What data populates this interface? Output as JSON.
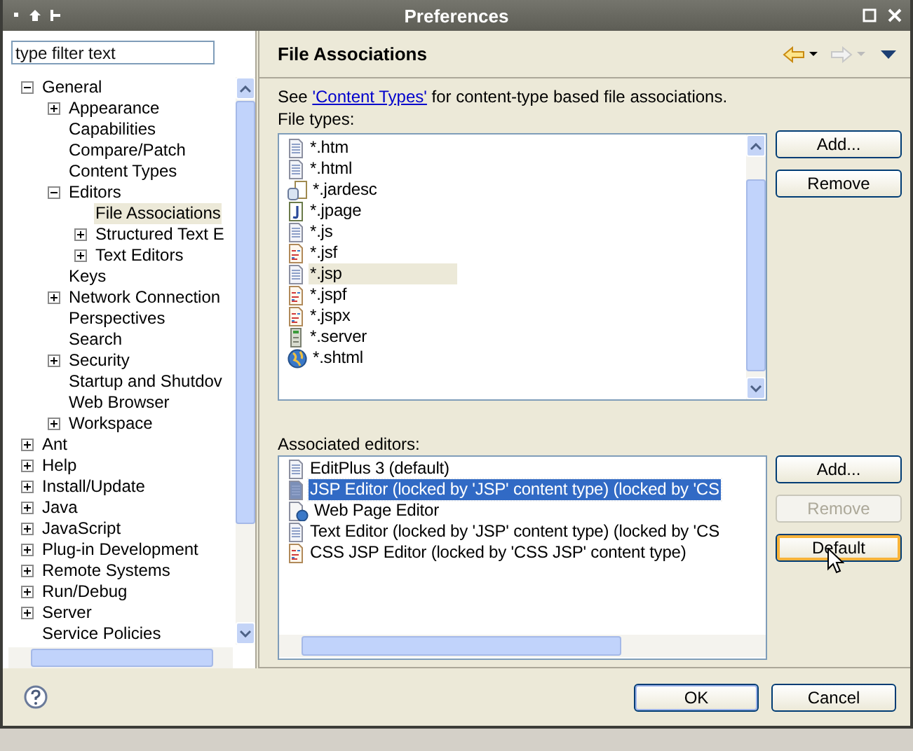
{
  "window": {
    "title": "Preferences"
  },
  "filter": {
    "placeholder": "type filter text"
  },
  "tree": [
    {
      "label": "General",
      "expanded": true,
      "selected": false,
      "children": [
        {
          "label": "Appearance",
          "expanded": false,
          "selected": false
        },
        {
          "label": "Capabilities",
          "selected": false
        },
        {
          "label": "Compare/Patch",
          "selected": false
        },
        {
          "label": "Content Types",
          "selected": false
        },
        {
          "label": "Editors",
          "expanded": true,
          "selected": false,
          "children": [
            {
              "label": "File Associations",
              "selected": true
            },
            {
              "label": "Structured Text E",
              "expanded": false,
              "selected": false
            },
            {
              "label": "Text Editors",
              "expanded": false,
              "selected": false
            }
          ]
        },
        {
          "label": "Keys",
          "selected": false
        },
        {
          "label": "Network Connection",
          "expanded": false,
          "selected": false
        },
        {
          "label": "Perspectives",
          "selected": false
        },
        {
          "label": "Search",
          "selected": false
        },
        {
          "label": "Security",
          "expanded": false,
          "selected": false
        },
        {
          "label": "Startup and Shutdov",
          "selected": false
        },
        {
          "label": "Web Browser",
          "selected": false
        },
        {
          "label": "Workspace",
          "expanded": false,
          "selected": false
        }
      ]
    },
    {
      "label": "Ant",
      "expanded": false,
      "selected": false
    },
    {
      "label": "Help",
      "expanded": false,
      "selected": false
    },
    {
      "label": "Install/Update",
      "expanded": false,
      "selected": false
    },
    {
      "label": "Java",
      "expanded": false,
      "selected": false
    },
    {
      "label": "JavaScript",
      "expanded": false,
      "selected": false
    },
    {
      "label": "Plug-in Development",
      "expanded": false,
      "selected": false
    },
    {
      "label": "Remote Systems",
      "expanded": false,
      "selected": false
    },
    {
      "label": "Run/Debug",
      "expanded": false,
      "selected": false
    },
    {
      "label": "Server",
      "expanded": false,
      "selected": false
    },
    {
      "label": "Service Policies",
      "selected": false
    }
  ],
  "page": {
    "title": "File Associations",
    "intro_before": "See ",
    "link": "'Content Types'",
    "intro_after": " for content-type based file associations."
  },
  "file_types": {
    "label": "File types:",
    "items": [
      {
        "name": "*.htm",
        "kind": "doc",
        "selected": false
      },
      {
        "name": "*.html",
        "kind": "doc",
        "selected": false
      },
      {
        "name": "*.jardesc",
        "kind": "jar",
        "selected": false
      },
      {
        "name": "*.jpage",
        "kind": "jpage",
        "selected": false
      },
      {
        "name": "*.js",
        "kind": "doc",
        "selected": false
      },
      {
        "name": "*.jsf",
        "kind": "form",
        "selected": false
      },
      {
        "name": "*.jsp",
        "kind": "doc",
        "selected": true
      },
      {
        "name": "*.jspf",
        "kind": "form",
        "selected": false
      },
      {
        "name": "*.jspx",
        "kind": "form",
        "selected": false
      },
      {
        "name": "*.server",
        "kind": "server",
        "selected": false
      },
      {
        "name": "*.shtml",
        "kind": "globe",
        "selected": false
      }
    ]
  },
  "file_buttons": [
    {
      "label": "Add...",
      "disabled": false,
      "focused": false
    },
    {
      "label": "Remove",
      "disabled": false,
      "focused": false
    }
  ],
  "editors": {
    "label": "Associated editors:",
    "items": [
      {
        "name": "EditPlus 3 (default)",
        "kind": "doc",
        "selected": false
      },
      {
        "name": "JSP Editor (locked by 'JSP' content type) (locked by 'CS",
        "kind": "doc",
        "selected": true
      },
      {
        "name": "Web Page Editor",
        "kind": "web",
        "selected": false
      },
      {
        "name": "Text Editor (locked by 'JSP' content type) (locked by 'CS",
        "kind": "doc",
        "selected": false
      },
      {
        "name": "CSS JSP Editor (locked by 'CSS JSP' content type)",
        "kind": "form",
        "selected": false
      }
    ]
  },
  "editor_buttons": [
    {
      "label": "Add...",
      "disabled": false,
      "focused": false
    },
    {
      "label": "Remove",
      "disabled": true,
      "focused": false
    },
    {
      "label": "Default",
      "disabled": false,
      "focused": true
    }
  ],
  "dialog_buttons": [
    {
      "label": "OK",
      "default": true
    },
    {
      "label": "Cancel",
      "default": false
    }
  ]
}
